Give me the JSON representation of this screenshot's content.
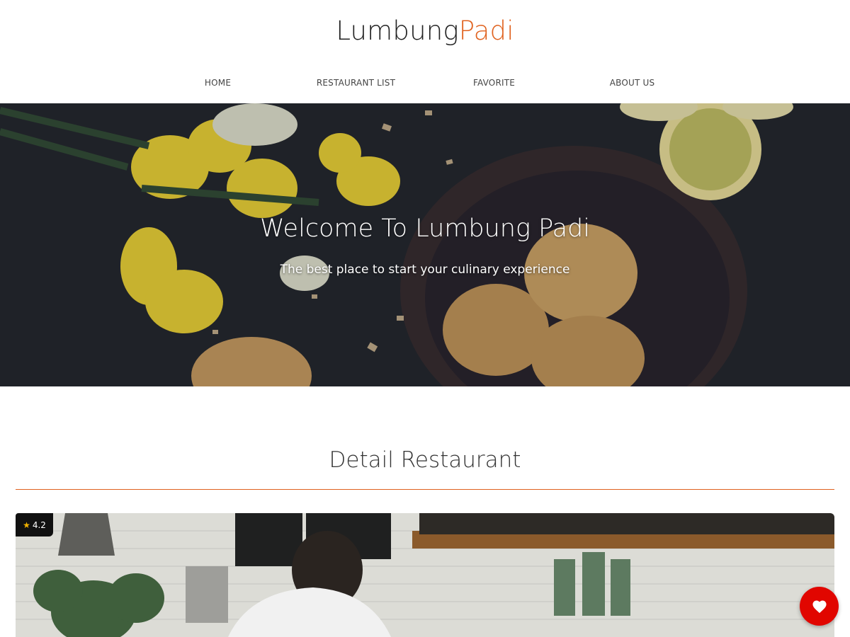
{
  "brand": {
    "name_part1": "Lumbung",
    "name_part2": "Padi",
    "accent_color": "#e0621f"
  },
  "nav": {
    "items": [
      {
        "label": "HOME"
      },
      {
        "label": "RESTAURANT LIST"
      },
      {
        "label": "FAVORITE"
      },
      {
        "label": "ABOUT US"
      }
    ]
  },
  "hero": {
    "title": "Welcome To Lumbung Padi",
    "subtitle": "The best place to start your culinary experience"
  },
  "detail": {
    "section_title": "Detail Restaurant",
    "rating": "4.2",
    "rating_icon": "star-icon"
  },
  "favorite": {
    "icon": "heart-icon",
    "color": "#e10600"
  }
}
